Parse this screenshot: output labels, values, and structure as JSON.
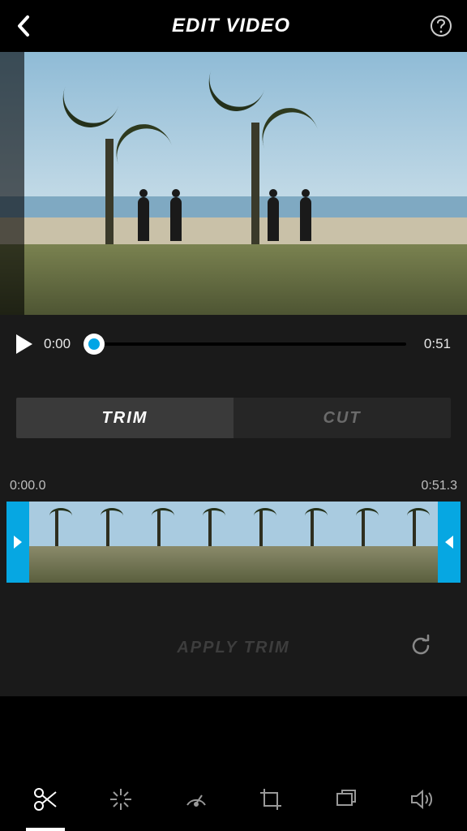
{
  "header": {
    "title": "EDIT VIDEO"
  },
  "player": {
    "current_time": "0:00",
    "duration": "0:51"
  },
  "tabs": {
    "trim_label": "TRIM",
    "cut_label": "CUT",
    "active": "trim"
  },
  "trim": {
    "start_time": "0:00.0",
    "end_time": "0:51.3"
  },
  "actions": {
    "apply_label": "APPLY TRIM"
  },
  "tools": {
    "items": [
      "trim",
      "highlights",
      "speed",
      "crop",
      "frame",
      "audio"
    ],
    "active": "trim"
  },
  "colors": {
    "accent": "#06a7e2"
  }
}
